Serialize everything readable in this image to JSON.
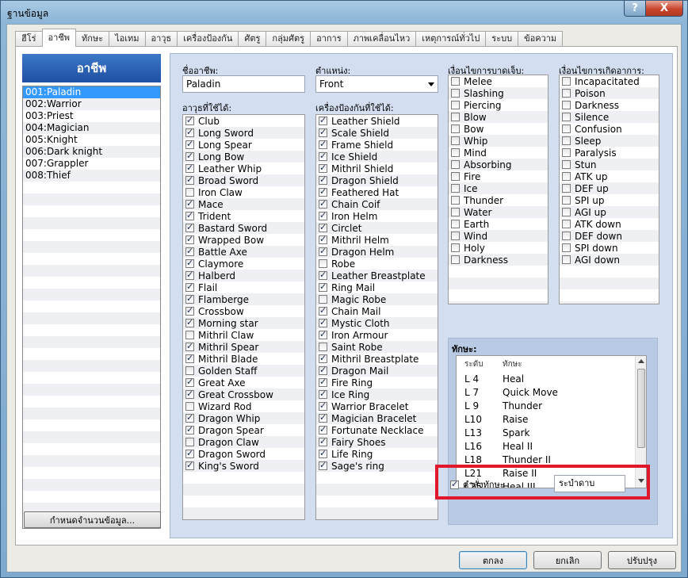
{
  "window": {
    "title": "ฐานข้อมูล",
    "help_label": "?",
    "close_label": "X"
  },
  "tabs": [
    "ฮีโร่",
    "อาชีพ",
    "ทักษะ",
    "ไอเทม",
    "อาวุธ",
    "เครื่องป้องกัน",
    "ศัตรู",
    "กลุ่มศัตรู",
    "อาการ",
    "ภาพเคลื่อนไหว",
    "เหตุการณ์ทั่วไป",
    "ระบบ",
    "ข้อความ"
  ],
  "active_tab_index": 1,
  "class_panel": {
    "header": "อาชีพ",
    "items": [
      "001:Paladin",
      "002:Warrior",
      "003:Priest",
      "004:Magician",
      "005:Knight",
      "006:Dark knight",
      "007:Grappler",
      "008:Thief"
    ],
    "selected_index": 0,
    "change_max_label": "กำหนดจำนวนข้อมูล..."
  },
  "fields": {
    "name_label": "ชื่ออาชีพ:",
    "name_value": "Paladin",
    "position_label": "ตำแหน่ง:",
    "position_value": "Front",
    "weapons_label": "อาวุธที่ใช้ได้:",
    "armors_label": "เครื่องป้องกันที่ใช้ได้:",
    "element_label": "เงื่อนไขการบาดเจ็บ:",
    "state_label": "เงื่อนไขการเกิดอาการ:"
  },
  "weapons": [
    {
      "name": "Club",
      "checked": true
    },
    {
      "name": "Long Sword",
      "checked": true
    },
    {
      "name": "Long Spear",
      "checked": true
    },
    {
      "name": "Long Bow",
      "checked": true
    },
    {
      "name": "Leather Whip",
      "checked": true
    },
    {
      "name": "Broad Sword",
      "checked": true
    },
    {
      "name": "Iron Claw",
      "checked": false
    },
    {
      "name": "Mace",
      "checked": true
    },
    {
      "name": "Trident",
      "checked": true
    },
    {
      "name": "Bastard Sword",
      "checked": true
    },
    {
      "name": "Wrapped Bow",
      "checked": true
    },
    {
      "name": "Battle Axe",
      "checked": true
    },
    {
      "name": "Claymore",
      "checked": true
    },
    {
      "name": "Halberd",
      "checked": true
    },
    {
      "name": "Flail",
      "checked": true
    },
    {
      "name": "Flamberge",
      "checked": true
    },
    {
      "name": "Crossbow",
      "checked": true
    },
    {
      "name": "Morning star",
      "checked": true
    },
    {
      "name": "Mithril Claw",
      "checked": false
    },
    {
      "name": "Mithril Spear",
      "checked": true
    },
    {
      "name": "Mithril Blade",
      "checked": true
    },
    {
      "name": "Golden Staff",
      "checked": false
    },
    {
      "name": "Great Axe",
      "checked": true
    },
    {
      "name": "Great Crossbow",
      "checked": true
    },
    {
      "name": "Wizard Rod",
      "checked": false
    },
    {
      "name": "Dragon Whip",
      "checked": true
    },
    {
      "name": "Dragon Spear",
      "checked": true
    },
    {
      "name": "Dragon Claw",
      "checked": false
    },
    {
      "name": "Dragon Sword",
      "checked": true
    },
    {
      "name": "King's Sword",
      "checked": true
    }
  ],
  "armors": [
    {
      "name": "Leather Shield",
      "checked": true
    },
    {
      "name": "Scale Shield",
      "checked": true
    },
    {
      "name": "Frame Shield",
      "checked": true
    },
    {
      "name": "Ice Shield",
      "checked": true
    },
    {
      "name": "Mithril Shield",
      "checked": true
    },
    {
      "name": "Dragon Shield",
      "checked": true
    },
    {
      "name": "Feathered Hat",
      "checked": true
    },
    {
      "name": "Chain Coif",
      "checked": true
    },
    {
      "name": "Iron Helm",
      "checked": true
    },
    {
      "name": "Circlet",
      "checked": true
    },
    {
      "name": "Mithril Helm",
      "checked": true
    },
    {
      "name": "Dragon Helm",
      "checked": true
    },
    {
      "name": "Robe",
      "checked": false
    },
    {
      "name": "Leather Breastplate",
      "checked": true
    },
    {
      "name": "Ring Mail",
      "checked": true
    },
    {
      "name": "Magic Robe",
      "checked": false
    },
    {
      "name": "Chain Mail",
      "checked": true
    },
    {
      "name": "Mystic Cloth",
      "checked": true
    },
    {
      "name": "Iron Armour",
      "checked": true
    },
    {
      "name": "Saint Robe",
      "checked": false
    },
    {
      "name": "Mithril Breastplate",
      "checked": true
    },
    {
      "name": "Dragon Mail",
      "checked": true
    },
    {
      "name": "Fire Ring",
      "checked": true
    },
    {
      "name": "Ice Ring",
      "checked": true
    },
    {
      "name": "Warrior Bracelet",
      "checked": true
    },
    {
      "name": "Magician Bracelet",
      "checked": true
    },
    {
      "name": "Fortunate Necklace",
      "checked": true
    },
    {
      "name": "Fairy Shoes",
      "checked": true
    },
    {
      "name": "Life Ring",
      "checked": true
    },
    {
      "name": "Sage's ring",
      "checked": true
    }
  ],
  "elements": [
    {
      "name": "Melee",
      "checked": false
    },
    {
      "name": "Slashing",
      "checked": false
    },
    {
      "name": "Piercing",
      "checked": false
    },
    {
      "name": "Blow",
      "checked": false
    },
    {
      "name": "Bow",
      "checked": false
    },
    {
      "name": "Whip",
      "checked": false
    },
    {
      "name": "Mind",
      "checked": false
    },
    {
      "name": "Absorbing",
      "checked": false
    },
    {
      "name": "Fire",
      "checked": false
    },
    {
      "name": "Ice",
      "checked": false
    },
    {
      "name": "Thunder",
      "checked": false
    },
    {
      "name": "Water",
      "checked": false
    },
    {
      "name": "Earth",
      "checked": false
    },
    {
      "name": "Wind",
      "checked": false
    },
    {
      "name": "Holy",
      "checked": false
    },
    {
      "name": "Darkness",
      "checked": false
    }
  ],
  "states": [
    {
      "name": "Incapacitated",
      "checked": false
    },
    {
      "name": "Poison",
      "checked": false
    },
    {
      "name": "Darkness",
      "checked": false
    },
    {
      "name": "Silence",
      "checked": false
    },
    {
      "name": "Confusion",
      "checked": false
    },
    {
      "name": "Sleep",
      "checked": false
    },
    {
      "name": "Paralysis",
      "checked": false
    },
    {
      "name": "Stun",
      "checked": false
    },
    {
      "name": "ATK up",
      "checked": false
    },
    {
      "name": "DEF up",
      "checked": false
    },
    {
      "name": "SPI up",
      "checked": false
    },
    {
      "name": "AGI up",
      "checked": false
    },
    {
      "name": "ATK down",
      "checked": false
    },
    {
      "name": "DEF down",
      "checked": false
    },
    {
      "name": "SPI down",
      "checked": false
    },
    {
      "name": "AGI down",
      "checked": false
    }
  ],
  "skills": {
    "title": "ทักษะ:",
    "col_level": "ระดับ",
    "col_skill": "ทักษะ",
    "rows": [
      {
        "level": "L 4",
        "skill": "Heal"
      },
      {
        "level": "L 7",
        "skill": "Quick Move"
      },
      {
        "level": "L 9",
        "skill": "Thunder"
      },
      {
        "level": "L10",
        "skill": "Raise"
      },
      {
        "level": "L13",
        "skill": "Spark"
      },
      {
        "level": "L16",
        "skill": "Heal II"
      },
      {
        "level": "L18",
        "skill": "Thunder II"
      },
      {
        "level": "L21",
        "skill": "Raise II"
      },
      {
        "level": "L25",
        "skill": "Heal III"
      }
    ],
    "command_label": "คำสั่งทักษะ",
    "command_checked": true,
    "command_value": "ระบำดาบ"
  },
  "buttons": {
    "ok": "ตกลง",
    "cancel": "ยกเลิก",
    "apply": "ปรับปรุง"
  },
  "colors": {
    "highlight": "#e0182c",
    "selection": "#3399ff",
    "header": "#2a5fb3"
  }
}
